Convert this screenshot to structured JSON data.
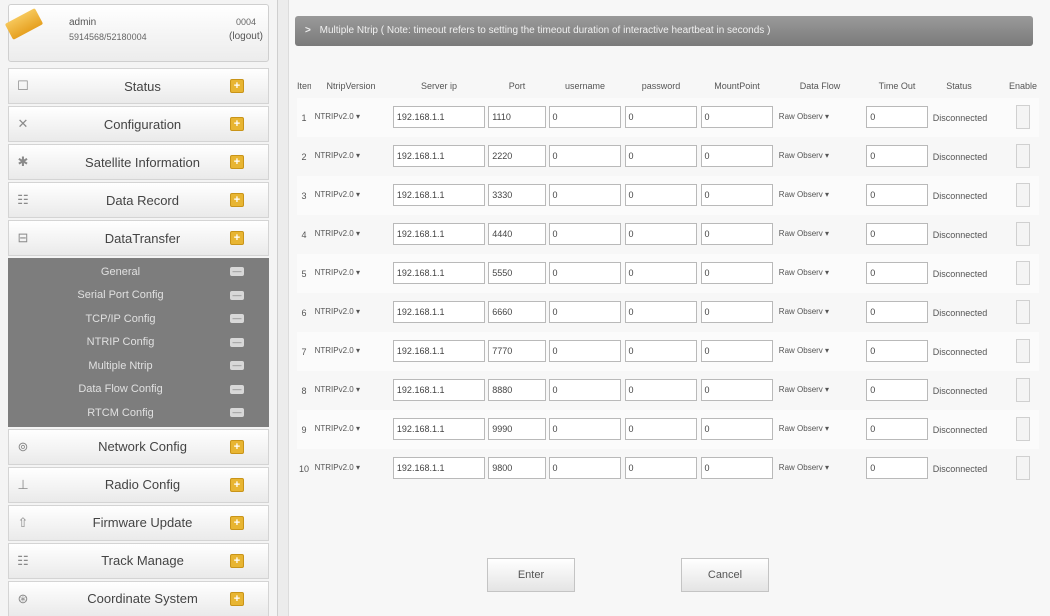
{
  "user": {
    "name": "admin",
    "id": "5914568/52180004",
    "code": "0004",
    "logout": "(logout)"
  },
  "nav_top": [
    {
      "icon": "☐",
      "icon_name": "monitor-icon",
      "label": "Status"
    },
    {
      "icon": "✕",
      "icon_name": "tools-icon",
      "label": "Configuration"
    },
    {
      "icon": "✱",
      "icon_name": "satellite-icon",
      "label": "Satellite Information"
    },
    {
      "icon": "☷",
      "icon_name": "record-icon",
      "label": "Data Record"
    },
    {
      "icon": "⊟",
      "icon_name": "transfer-icon",
      "label": "DataTransfer"
    }
  ],
  "subnav": [
    {
      "label": "General"
    },
    {
      "label": "Serial Port Config"
    },
    {
      "label": "TCP/IP Config"
    },
    {
      "label": "NTRIP Config"
    },
    {
      "label": "Multiple Ntrip"
    },
    {
      "label": "Data Flow Config"
    },
    {
      "label": "RTCM Config"
    }
  ],
  "nav_bottom": [
    {
      "icon": "⊚",
      "icon_name": "network-icon",
      "label": "Network Config"
    },
    {
      "icon": "⊥",
      "icon_name": "radio-icon",
      "label": "Radio Config"
    },
    {
      "icon": "⇧",
      "icon_name": "firmware-icon",
      "label": "Firmware Update"
    },
    {
      "icon": "☷",
      "icon_name": "track-icon",
      "label": "Track Manage"
    },
    {
      "icon": "⊛",
      "icon_name": "coordinate-icon",
      "label": "Coordinate System"
    }
  ],
  "notice": "Multiple Ntrip ( Note: timeout refers to setting the timeout duration of interactive heartbeat in seconds )",
  "columns": [
    "Item",
    "NtripVersion",
    "Server ip",
    "Port",
    "username",
    "password",
    "MountPoint",
    "Data Flow",
    "Time Out",
    "Status",
    "Enable"
  ],
  "rows": [
    {
      "item": "1",
      "version": "NTRIPv2.0",
      "ip": "192.168.1.1",
      "port": "1110",
      "username": "0",
      "password": "0",
      "mount": "0",
      "flow": "Raw Observ",
      "timeout": "0",
      "status": "Disconnected"
    },
    {
      "item": "2",
      "version": "NTRIPv2.0",
      "ip": "192.168.1.1",
      "port": "2220",
      "username": "0",
      "password": "0",
      "mount": "0",
      "flow": "Raw Observ",
      "timeout": "0",
      "status": "Disconnected"
    },
    {
      "item": "3",
      "version": "NTRIPv2.0",
      "ip": "192.168.1.1",
      "port": "3330",
      "username": "0",
      "password": "0",
      "mount": "0",
      "flow": "Raw Observ",
      "timeout": "0",
      "status": "Disconnected"
    },
    {
      "item": "4",
      "version": "NTRIPv2.0",
      "ip": "192.168.1.1",
      "port": "4440",
      "username": "0",
      "password": "0",
      "mount": "0",
      "flow": "Raw Observ",
      "timeout": "0",
      "status": "Disconnected"
    },
    {
      "item": "5",
      "version": "NTRIPv2.0",
      "ip": "192.168.1.1",
      "port": "5550",
      "username": "0",
      "password": "0",
      "mount": "0",
      "flow": "Raw Observ",
      "timeout": "0",
      "status": "Disconnected"
    },
    {
      "item": "6",
      "version": "NTRIPv2.0",
      "ip": "192.168.1.1",
      "port": "6660",
      "username": "0",
      "password": "0",
      "mount": "0",
      "flow": "Raw Observ",
      "timeout": "0",
      "status": "Disconnected"
    },
    {
      "item": "7",
      "version": "NTRIPv2.0",
      "ip": "192.168.1.1",
      "port": "7770",
      "username": "0",
      "password": "0",
      "mount": "0",
      "flow": "Raw Observ",
      "timeout": "0",
      "status": "Disconnected"
    },
    {
      "item": "8",
      "version": "NTRIPv2.0",
      "ip": "192.168.1.1",
      "port": "8880",
      "username": "0",
      "password": "0",
      "mount": "0",
      "flow": "Raw Observ",
      "timeout": "0",
      "status": "Disconnected"
    },
    {
      "item": "9",
      "version": "NTRIPv2.0",
      "ip": "192.168.1.1",
      "port": "9990",
      "username": "0",
      "password": "0",
      "mount": "0",
      "flow": "Raw Observ",
      "timeout": "0",
      "status": "Disconnected"
    },
    {
      "item": "10",
      "version": "NTRIPv2.0",
      "ip": "192.168.1.1",
      "port": "9800",
      "username": "0",
      "password": "0",
      "mount": "0",
      "flow": "Raw Observ",
      "timeout": "0",
      "status": "Disconnected"
    }
  ],
  "buttons": {
    "enter": "Enter",
    "cancel": "Cancel"
  },
  "colors": {
    "accent": "#e8b532",
    "subnav_bg": "#7d7d7d",
    "notice_bg": "#8a8a8a"
  }
}
